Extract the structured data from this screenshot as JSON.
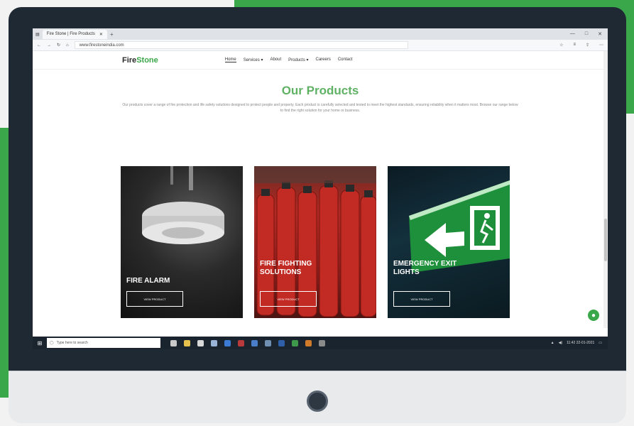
{
  "browser": {
    "tab_title": "Fire Stone | Fire Products",
    "new_tab": "+",
    "url": "www.firestoneindia.com",
    "window_controls": [
      "—",
      "□",
      "✕"
    ]
  },
  "site": {
    "logo_main": "Fire",
    "logo_accent": "Stone",
    "menu": [
      "Home",
      "Services ▾",
      "About",
      "Products ▾",
      "Careers",
      "Contact"
    ],
    "active_menu_index": 0
  },
  "main": {
    "title": "Our Products",
    "intro": "Our products cover a range of fire protection and life safety solutions designed to protect people and property. Each product is carefully selected and tested to meet the highest standards, ensuring reliability when it matters most. Browse our range below to find the right solution for your home or business."
  },
  "cards": [
    {
      "title_line1": "FIRE ALARM",
      "title_line2": "",
      "button": "VIEW PRODUCT",
      "icon": "smoke-detector-icon"
    },
    {
      "title_line1": "FIRE FIGHTING",
      "title_line2": "SOLUTIONS",
      "button": "VIEW PRODUCT",
      "icon": "fire-extinguisher-icon"
    },
    {
      "title_line1": "EMERGENCY EXIT",
      "title_line2": "LIGHTS",
      "button": "VIEW PRODUCT",
      "icon": "exit-sign-icon"
    }
  ],
  "taskbar": {
    "search_placeholder": "Type here to search",
    "clock": "11:42",
    "date": "22-01-2021"
  },
  "colors": {
    "brand_green": "#3aa74a",
    "bezel": "#1f2933"
  }
}
